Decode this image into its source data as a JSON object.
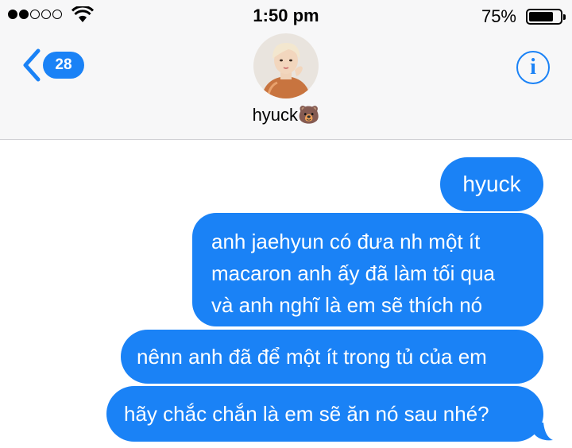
{
  "status_bar": {
    "signal_bars_filled": 2,
    "signal_bars_total": 5,
    "time": "1:50 pm",
    "battery_percent": "75%",
    "battery_level": 0.75
  },
  "header": {
    "back_count": "28",
    "contact_name": "hyuck🐻",
    "info_label": "i"
  },
  "messages": [
    {
      "lines": [
        "hyuck"
      ]
    },
    {
      "lines": [
        "anh jaehyun có đưa nh một ít",
        "macaron anh ấy đã làm tối qua",
        "và anh nghĩ là em sẽ thích nó"
      ]
    },
    {
      "lines": [
        "nênn anh đã để một ít trong tủ của em"
      ]
    },
    {
      "lines": [
        "hãy chắc chắn là em sẽ ăn nó sau nhé?"
      ]
    }
  ],
  "colors": {
    "bubble": "#1a82f6",
    "accent": "#1a82f6"
  }
}
